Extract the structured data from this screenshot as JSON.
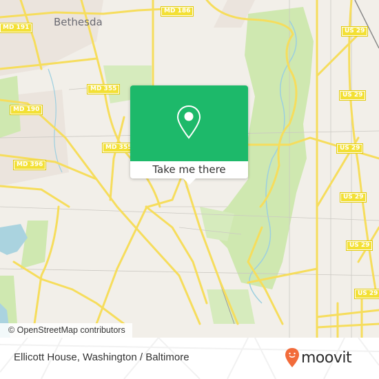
{
  "map": {
    "city_label": "Bethesda",
    "route_shields": [
      {
        "label": "MD 191"
      },
      {
        "label": "MD 186"
      },
      {
        "label": "MD 355"
      },
      {
        "label": "MD 190"
      },
      {
        "label": "MD 355"
      },
      {
        "label": "MD 396"
      },
      {
        "label": "US 29"
      },
      {
        "label": "US 29"
      },
      {
        "label": "US 29"
      },
      {
        "label": "US 29"
      },
      {
        "label": "US 29"
      },
      {
        "label": "US 29"
      }
    ],
    "attribution": "© OpenStreetMap contributors",
    "colors": {
      "land": "#f2efe9",
      "park": "#cfe8b0",
      "water": "#aad3df",
      "road_major": "#f6dd5c",
      "road_minor": "#c9c6c0",
      "shield": "#f3e034"
    }
  },
  "popup": {
    "button_label": "Take me there",
    "icon": "map-pin-icon",
    "color": "#1db96a"
  },
  "footer": {
    "title": "Ellicott House, Washington / Baltimore",
    "brand": "moovit",
    "brand_color": "#f26b3a"
  }
}
